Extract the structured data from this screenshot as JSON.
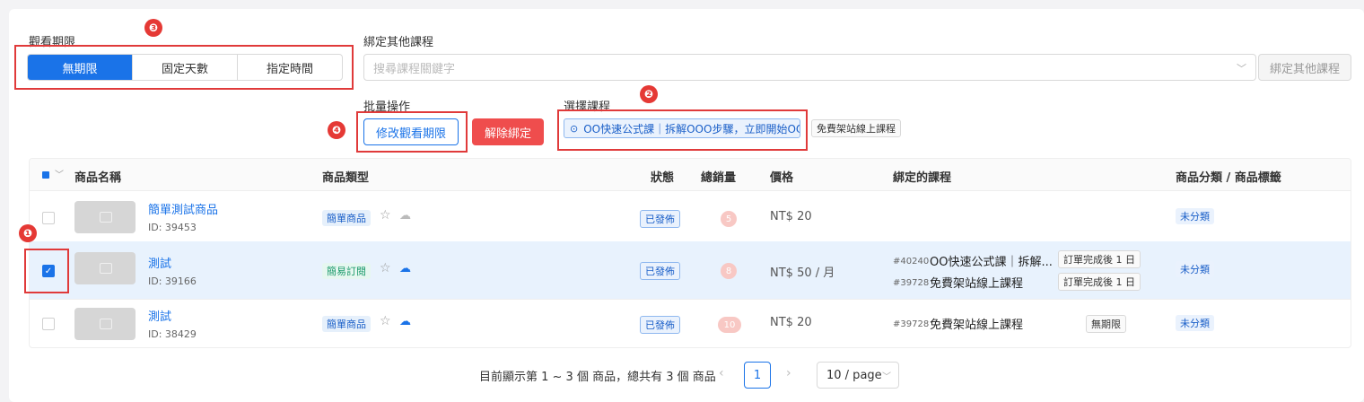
{
  "viewing_period": {
    "label": "觀看期限",
    "options": [
      "無期限",
      "固定天數",
      "指定時間"
    ],
    "selected": 0
  },
  "bind_other": {
    "label": "綁定其他課程",
    "search_placeholder": "搜尋課程關鍵字",
    "button_label": "綁定其他課程"
  },
  "batch": {
    "label": "批量操作",
    "modify_label": "修改觀看期限",
    "unbind_label": "解除綁定"
  },
  "select_course": {
    "label": "選擇課程",
    "selected_tag": "OO快速公式課｜拆解OOO步驟，立即開始OOO",
    "other_tag": "免費架站線上課程"
  },
  "callouts": [
    "❶",
    "❷",
    "❸",
    "❹"
  ],
  "table": {
    "columns": [
      "商品名稱",
      "商品類型",
      "狀態",
      "總銷量",
      "價格",
      "綁定的課程",
      "商品分類 / 商品標籤"
    ],
    "rows": [
      {
        "name": "簡單測試商品",
        "id": "ID: 39453",
        "type": "簡單商品",
        "status": "已發佈",
        "sales": "5",
        "price": "NT$  20",
        "bound": [],
        "category": "未分類",
        "checked": false
      },
      {
        "name": "測試",
        "id": "ID: 39166",
        "type": "簡易訂閱",
        "status": "已發佈",
        "sales": "8",
        "price": "NT$  50 / 月",
        "bound": [
          {
            "id": "#40240",
            "name": "OO快速公式課｜拆解...",
            "period": "訂單完成後 1 日"
          },
          {
            "id": "#39728",
            "name": "免費架站線上課程",
            "period": "訂單完成後 1 日"
          }
        ],
        "category": "未分類",
        "checked": true
      },
      {
        "name": "測試",
        "id": "ID: 38429",
        "type": "簡單商品",
        "status": "已發佈",
        "sales": "10",
        "price": "NT$  20",
        "bound": [
          {
            "id": "#39728",
            "name": "免費架站線上課程",
            "period": "無期限"
          }
        ],
        "category": "未分類",
        "checked": false
      }
    ]
  },
  "pagination": {
    "summary": "目前顯示第 1 ~ 3 個 商品，總共有 3 個 商品",
    "current_page": "1",
    "page_size": "10 / page"
  },
  "colors": {
    "primary": "#1a73e8",
    "danger": "#ef4d4d",
    "callout": "#e53935"
  }
}
